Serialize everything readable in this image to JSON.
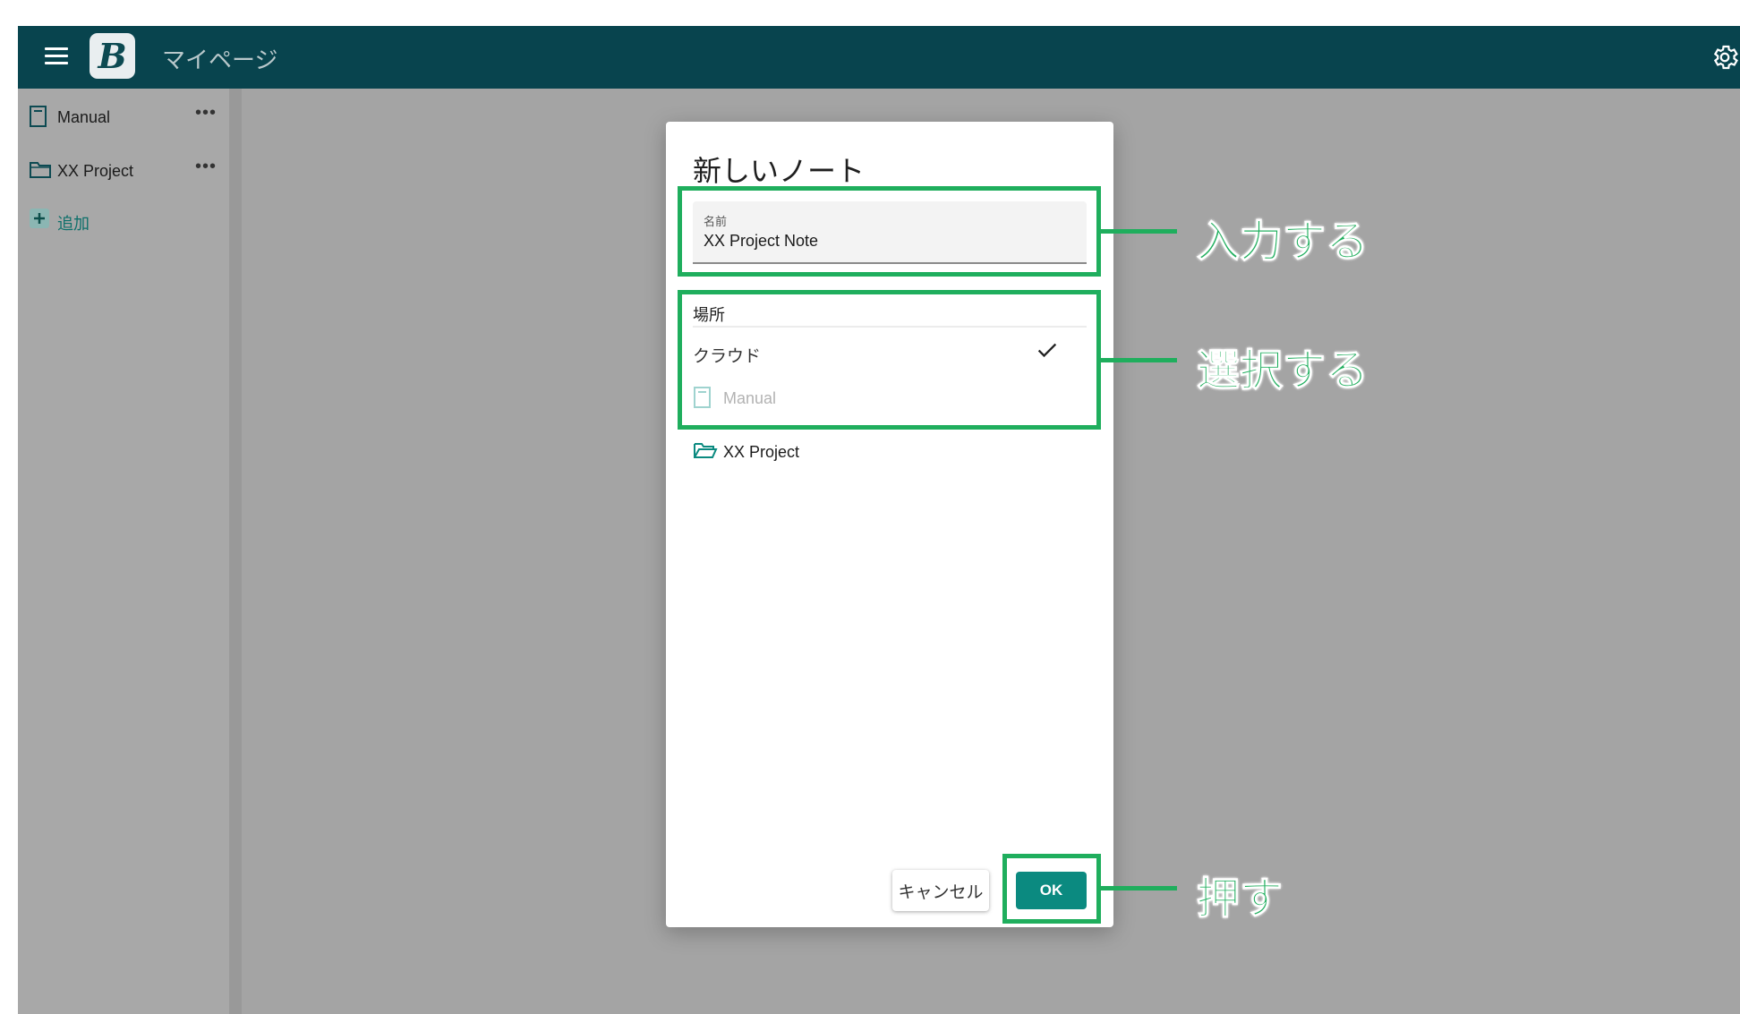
{
  "header": {
    "app_title": "マイページ",
    "logo_letter": "B",
    "menu_icon": "hamburger-menu-icon",
    "settings_icon": "gear-icon",
    "bar_color": "#08444e"
  },
  "sidebar": {
    "items": [
      {
        "label": "Manual",
        "icon": "notebook-icon",
        "more": "•••"
      },
      {
        "label": "XX Project",
        "icon": "folder-icon",
        "more": "•••"
      }
    ],
    "add_label": "追加"
  },
  "dialog": {
    "title": "新しいノート",
    "name_field": {
      "label": "名前",
      "value": "XX Project Note"
    },
    "location_label": "場所",
    "locations": [
      {
        "label": "クラウド",
        "selected": true,
        "icon": "checkmark-icon"
      },
      {
        "label": "Manual",
        "disabled": true,
        "icon": "notebook-icon"
      },
      {
        "label": "XX Project",
        "icon": "folder-open-icon"
      }
    ],
    "cancel_label": "キャンセル",
    "ok_label": "OK",
    "ok_color": "#0b8a80"
  },
  "annotations": {
    "input": "入力する",
    "select": "選択する",
    "press": "押す",
    "color": "#1fae5d"
  }
}
